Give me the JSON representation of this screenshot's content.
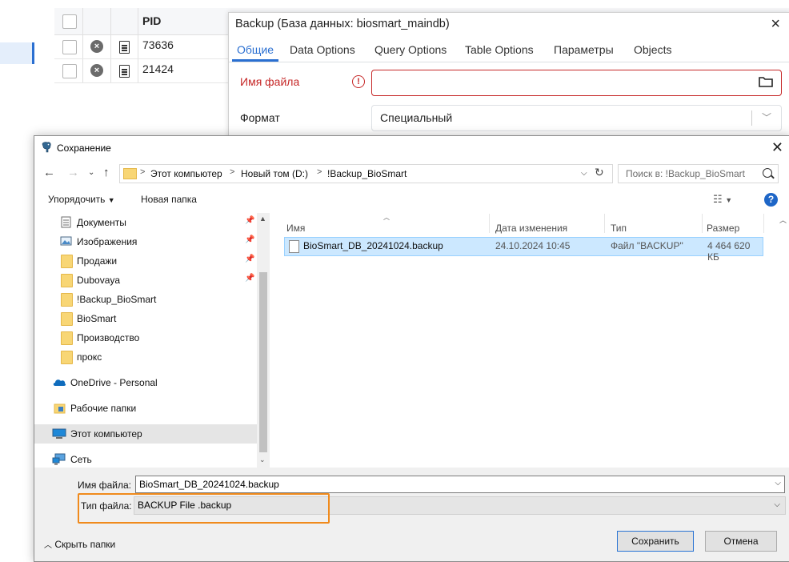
{
  "background_table": {
    "header": "PID",
    "rows": [
      {
        "pid": "73636"
      },
      {
        "pid": "21424"
      }
    ]
  },
  "backup_dialog": {
    "title": "Backup (База данных: biosmart_maindb)",
    "close": "×",
    "tabs": [
      "Общие",
      "Data Options",
      "Query Options",
      "Table Options",
      "Параметры",
      "Objects"
    ],
    "filename_label": "Имя файла",
    "filename_value": "",
    "format_label": "Формат",
    "format_value": "Специальный",
    "colors": {
      "accent": "#2a6fd1",
      "error": "#c62828"
    }
  },
  "save_dialog": {
    "title": "Сохранение",
    "address": [
      "Этот компьютер",
      "Новый том (D:)",
      "!Backup_BioSmart"
    ],
    "search_placeholder": "Поиск в: !Backup_BioSmart",
    "organize_label": "Упорядочить",
    "new_folder_label": "Новая папка",
    "nav_items": [
      {
        "label": "Документы",
        "icon": "documents-icon",
        "pinned": true
      },
      {
        "label": "Изображения",
        "icon": "pictures-icon",
        "pinned": true
      },
      {
        "label": "Продажи",
        "icon": "folder-icon",
        "pinned": true
      },
      {
        "label": "Dubovaya",
        "icon": "folder-icon",
        "pinned": true
      },
      {
        "label": "!Backup_BioSmart",
        "icon": "folder-icon",
        "pinned": false
      },
      {
        "label": "BioSmart",
        "icon": "folder-icon",
        "pinned": false
      },
      {
        "label": "Производство",
        "icon": "folder-icon",
        "pinned": false
      },
      {
        "label": "прокс",
        "icon": "folder-icon",
        "pinned": false
      },
      {
        "label": "OneDrive - Personal",
        "icon": "cloud-icon",
        "pinned": false
      },
      {
        "label": "Рабочие папки",
        "icon": "work-folders-icon",
        "pinned": false
      },
      {
        "label": "Этот компьютер",
        "icon": "computer-icon",
        "pinned": false
      },
      {
        "label": "Сеть",
        "icon": "network-icon",
        "pinned": false
      }
    ],
    "columns": [
      "Имя",
      "Дата изменения",
      "Тип",
      "Размер"
    ],
    "files": [
      {
        "name": "BioSmart_DB_20241024.backup",
        "modified": "24.10.2024 10:45",
        "type": "Файл \"BACKUP\"",
        "size": "4 464 620 КБ"
      }
    ],
    "filename_label": "Имя файла:",
    "filename_value": "BioSmart_DB_20241024.backup",
    "filetype_label": "Тип файла:",
    "filetype_value": "BACKUP File .backup",
    "hide_folders_label": "Скрыть папки",
    "save_button": "Сохранить",
    "cancel_button": "Отмена",
    "colors": {
      "selection": "#cce8ff",
      "highlight_box": "#f08a1c",
      "default_button": "#2a74d4"
    }
  }
}
